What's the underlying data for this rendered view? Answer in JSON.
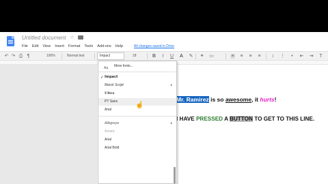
{
  "header": {
    "doc_title": "Untitled document",
    "star_icon": "☆",
    "saved_status": "All changes saved in Drive",
    "menu": [
      "File",
      "Edit",
      "View",
      "Insert",
      "Format",
      "Tools",
      "Add-ons",
      "Help"
    ]
  },
  "toolbar": {
    "undo": "↶",
    "redo": "↷",
    "print": "⎙",
    "paint": "¶",
    "zoom": "100%",
    "style": "Normal text",
    "font": "Impact",
    "size": "18",
    "bold": "B",
    "italic": "I",
    "underline": "U",
    "text_color": "A",
    "link": "⚭",
    "comment": "▭"
  },
  "dropdown": {
    "more_fonts": "More fonts...",
    "more_icon": "Aa",
    "current_font": "Impact",
    "check": "✓",
    "recent": [
      "Marck Script",
      "Ultra",
      "PT Sans",
      "Arial"
    ],
    "recent_arrow": "▸",
    "fonts_label": "Allegreya",
    "others": [
      "Amatic",
      "Arial",
      "Arial Bold"
    ],
    "pointer": "☝"
  },
  "document": {
    "line1": {
      "highlighted": "Mr. Ramirez",
      "mid": " is so ",
      "awesome": "awesome",
      "comma": ", it ",
      "hurts": "hurts",
      "end": "!"
    },
    "line2": {
      "start": "I HAVE ",
      "pressed": "PRESSED",
      "mid": " A ",
      "button": "BUTTON",
      "end": " TO GET TO THIS LINE."
    }
  },
  "colors": {
    "highlight_blue": "#1565c0",
    "pink": "#e91ec8",
    "green": "#2e7d32",
    "link_blue": "#1a73e8"
  }
}
